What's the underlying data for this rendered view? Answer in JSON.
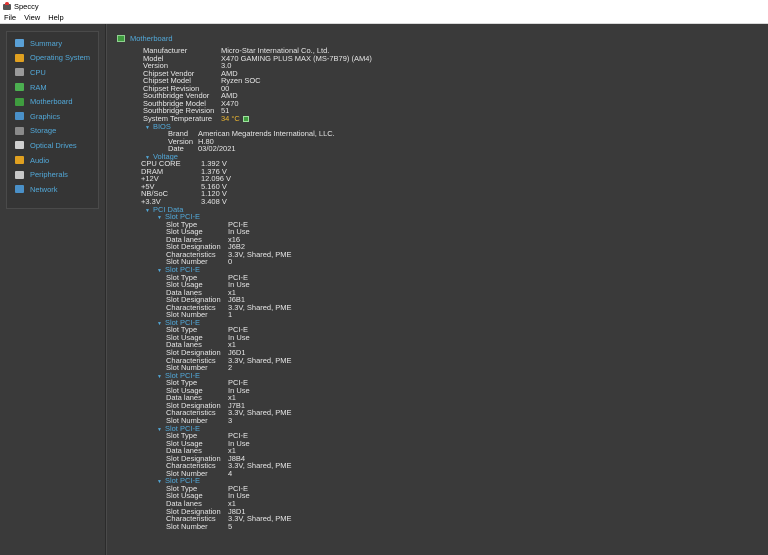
{
  "window": {
    "title": "Speccy",
    "icon": "speccy-app-icon"
  },
  "menu": [
    "File",
    "View",
    "Help"
  ],
  "sidebar": {
    "items": [
      {
        "label": "Summary",
        "icon": "summary-icon",
        "color": "#5aa0d6"
      },
      {
        "label": "Operating System",
        "icon": "windows-icon",
        "color": "#e0a020"
      },
      {
        "label": "CPU",
        "icon": "cpu-icon",
        "color": "#9a9a9a"
      },
      {
        "label": "RAM",
        "icon": "ram-icon",
        "color": "#4caf50"
      },
      {
        "label": "Motherboard",
        "icon": "motherboard-icon",
        "color": "#3f9c3f"
      },
      {
        "label": "Graphics",
        "icon": "monitor-icon",
        "color": "#4a90c8"
      },
      {
        "label": "Storage",
        "icon": "hdd-icon",
        "color": "#8a8a8a"
      },
      {
        "label": "Optical Drives",
        "icon": "disc-icon",
        "color": "#d0d0d0"
      },
      {
        "label": "Audio",
        "icon": "speaker-icon",
        "color": "#e0a020"
      },
      {
        "label": "Peripherals",
        "icon": "mouse-icon",
        "color": "#c8c8c8"
      },
      {
        "label": "Network",
        "icon": "network-icon",
        "color": "#4a90c8"
      }
    ]
  },
  "motherboard": {
    "title": "Motherboard",
    "props": [
      {
        "k": "Manufacturer",
        "v": "Micro-Star International Co., Ltd."
      },
      {
        "k": "Model",
        "v": "X470 GAMING PLUS MAX (MS-7B79) (AM4)"
      },
      {
        "k": "Version",
        "v": "3.0"
      },
      {
        "k": "Chipset Vendor",
        "v": "AMD"
      },
      {
        "k": "Chipset Model",
        "v": "Ryzen SOC"
      },
      {
        "k": "Chipset Revision",
        "v": "00"
      },
      {
        "k": "Southbridge Vendor",
        "v": "AMD"
      },
      {
        "k": "Southbridge Model",
        "v": "X470"
      },
      {
        "k": "Southbridge Revision",
        "v": "51"
      },
      {
        "k": "System Temperature",
        "v": "34 °C",
        "warm": true,
        "icon": "temperature-status-icon"
      }
    ],
    "bios": {
      "title": "BIOS",
      "props": [
        {
          "k": "Brand",
          "v": "American Megatrends International, LLC."
        },
        {
          "k": "Version",
          "v": "H.80"
        },
        {
          "k": "Date",
          "v": "03/02/2021"
        }
      ]
    },
    "voltage": {
      "title": "Voltage",
      "props": [
        {
          "k": "CPU CORE",
          "v": "1.392 V"
        },
        {
          "k": "DRAM",
          "v": "1.376 V"
        },
        {
          "k": "+12V",
          "v": "12.096 V"
        },
        {
          "k": "+5V",
          "v": "5.160 V"
        },
        {
          "k": "NB/SoC",
          "v": "1.120 V"
        },
        {
          "k": "+3.3V",
          "v": "3.408 V"
        }
      ]
    },
    "pci": {
      "title": "PCI Data",
      "slots": [
        {
          "title": "Slot PCI-E",
          "props": [
            {
              "k": "Slot Type",
              "v": "PCI-E"
            },
            {
              "k": "Slot Usage",
              "v": "In Use"
            },
            {
              "k": "Data lanes",
              "v": "x16"
            },
            {
              "k": "Slot Designation",
              "v": "J6B2"
            },
            {
              "k": "Characteristics",
              "v": "3.3V, Shared, PME"
            },
            {
              "k": "Slot Number",
              "v": "0"
            }
          ]
        },
        {
          "title": "Slot PCI-E",
          "props": [
            {
              "k": "Slot Type",
              "v": "PCI-E"
            },
            {
              "k": "Slot Usage",
              "v": "In Use"
            },
            {
              "k": "Data lanes",
              "v": "x1"
            },
            {
              "k": "Slot Designation",
              "v": "J6B1"
            },
            {
              "k": "Characteristics",
              "v": "3.3V, Shared, PME"
            },
            {
              "k": "Slot Number",
              "v": "1"
            }
          ]
        },
        {
          "title": "Slot PCI-E",
          "props": [
            {
              "k": "Slot Type",
              "v": "PCI-E"
            },
            {
              "k": "Slot Usage",
              "v": "In Use"
            },
            {
              "k": "Data lanes",
              "v": "x1"
            },
            {
              "k": "Slot Designation",
              "v": "J6D1"
            },
            {
              "k": "Characteristics",
              "v": "3.3V, Shared, PME"
            },
            {
              "k": "Slot Number",
              "v": "2"
            }
          ]
        },
        {
          "title": "Slot PCI-E",
          "props": [
            {
              "k": "Slot Type",
              "v": "PCI-E"
            },
            {
              "k": "Slot Usage",
              "v": "In Use"
            },
            {
              "k": "Data lanes",
              "v": "x1"
            },
            {
              "k": "Slot Designation",
              "v": "J7B1"
            },
            {
              "k": "Characteristics",
              "v": "3.3V, Shared, PME"
            },
            {
              "k": "Slot Number",
              "v": "3"
            }
          ]
        },
        {
          "title": "Slot PCI-E",
          "props": [
            {
              "k": "Slot Type",
              "v": "PCI-E"
            },
            {
              "k": "Slot Usage",
              "v": "In Use"
            },
            {
              "k": "Data lanes",
              "v": "x1"
            },
            {
              "k": "Slot Designation",
              "v": "J8B4"
            },
            {
              "k": "Characteristics",
              "v": "3.3V, Shared, PME"
            },
            {
              "k": "Slot Number",
              "v": "4"
            }
          ]
        },
        {
          "title": "Slot PCI-E",
          "props": [
            {
              "k": "Slot Type",
              "v": "PCI-E"
            },
            {
              "k": "Slot Usage",
              "v": "In Use"
            },
            {
              "k": "Data lanes",
              "v": "x1"
            },
            {
              "k": "Slot Designation",
              "v": "J8D1"
            },
            {
              "k": "Characteristics",
              "v": "3.3V, Shared, PME"
            },
            {
              "k": "Slot Number",
              "v": "5"
            }
          ]
        }
      ]
    }
  },
  "colors": {
    "accent": "#52a8d8",
    "background": "#3a3a3a",
    "text": "#e6e6e6",
    "temp_warm": "#e9b430"
  }
}
